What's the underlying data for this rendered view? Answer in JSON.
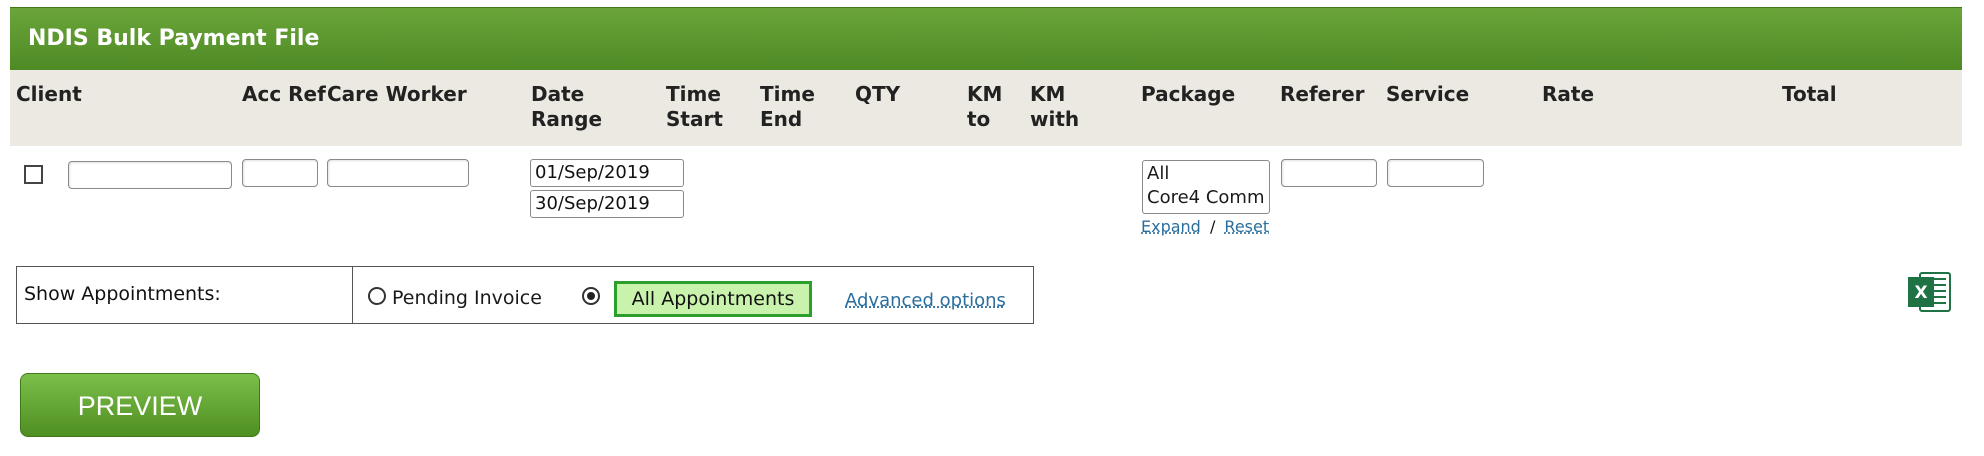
{
  "title": "NDIS Bulk Payment File",
  "columns": {
    "client": "Client",
    "acc_ref": "Acc Ref",
    "care_worker": "Care Worker",
    "date_range_1": "Date",
    "date_range_2": "Range",
    "time_start_1": "Time",
    "time_start_2": "Start",
    "time_end_1": "Time",
    "time_end_2": "End",
    "qty": "QTY",
    "km_to_1": "KM",
    "km_to_2": "to",
    "km_with_1": "KM",
    "km_with_2": "with",
    "package": "Package",
    "referer": "Referer",
    "service": "Service",
    "rate": "Rate",
    "total": "Total"
  },
  "filters": {
    "client_value": "",
    "acc_ref_value": "",
    "care_worker_value": "",
    "date_from": "01/Sep/2019",
    "date_to": "30/Sep/2019",
    "package_options": [
      "All",
      "Core4 Comm"
    ],
    "referer_value": "",
    "service_value": "",
    "expand_label": "Expand",
    "separator": "/",
    "reset_label": "Reset"
  },
  "show_appointments": {
    "label": "Show Appointments:",
    "pending_invoice_label": "Pending Invoice",
    "all_appointments_label": "All Appointments",
    "selected": "All Appointments",
    "advanced_options_label": "Advanced options"
  },
  "excel_icon_letter": "X",
  "preview_label": "PREVIEW",
  "colors": {
    "header_green": "#5a9a2e",
    "header_row_bg": "#ebe9e2",
    "link_blue": "#2a6e9e",
    "selected_option_bg": "#c9f2ad",
    "excel_green": "#1f7244"
  }
}
